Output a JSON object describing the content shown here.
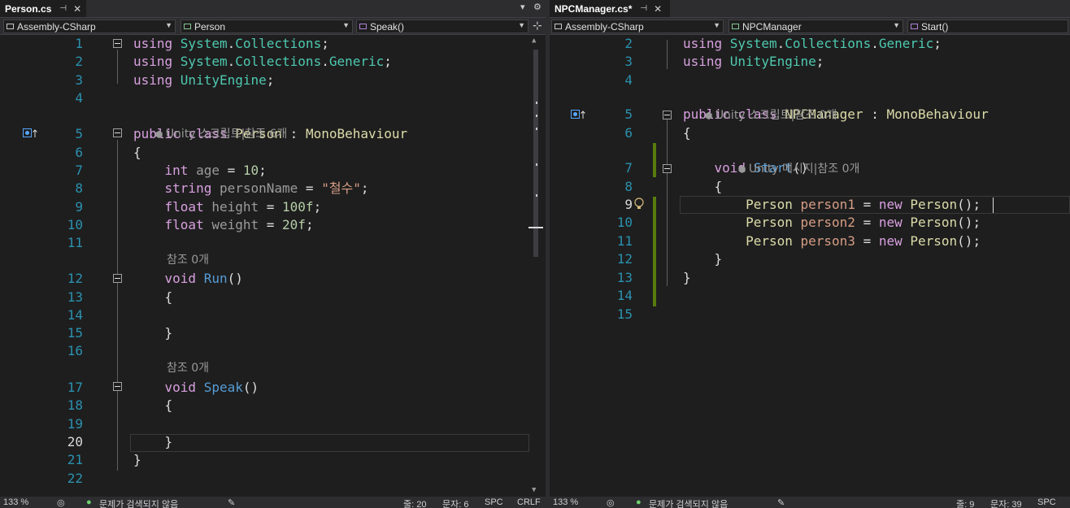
{
  "left_pane": {
    "tab_title": "Person.cs",
    "tab_pin": "⊣",
    "tab_close": "✕",
    "nav_project": "Assembly-CSharp",
    "nav_type": "Person",
    "nav_member": "Speak()",
    "lens_class": "Unity 스크립트|참조 6개",
    "lens_run": "참조 0개",
    "lens_speak": "참조 0개",
    "lines": [
      {
        "n": "1",
        "parts": [
          [
            "kw2",
            "using "
          ],
          [
            "ty",
            "System"
          ],
          [
            "ns",
            "."
          ],
          [
            "ty",
            "Collections"
          ],
          [
            "ns",
            ";"
          ]
        ]
      },
      {
        "n": "2",
        "parts": [
          [
            "kw2",
            "using "
          ],
          [
            "ty",
            "System"
          ],
          [
            "ns",
            "."
          ],
          [
            "ty",
            "Collections"
          ],
          [
            "ns",
            "."
          ],
          [
            "ty",
            "Generic"
          ],
          [
            "ns",
            ";"
          ]
        ]
      },
      {
        "n": "3",
        "parts": [
          [
            "kw2",
            "using "
          ],
          [
            "ty",
            "UnityEngine"
          ],
          [
            "ns",
            ";"
          ]
        ]
      },
      {
        "n": "4",
        "parts": []
      },
      {
        "n": "5",
        "parts": [
          [
            "kw2",
            "public "
          ],
          [
            "kw2",
            "class "
          ],
          [
            "fn",
            "Person"
          ],
          [
            "ns",
            " : "
          ],
          [
            "fn",
            "MonoBehaviour"
          ]
        ]
      },
      {
        "n": "6",
        "parts": [
          [
            "ns",
            "{"
          ]
        ]
      },
      {
        "n": "7",
        "parts": [
          [
            "ns",
            "    "
          ],
          [
            "kw2",
            "int "
          ],
          [
            "dim",
            "age"
          ],
          [
            "ns",
            " = "
          ],
          [
            "num",
            "10"
          ],
          [
            "ns",
            ";"
          ]
        ]
      },
      {
        "n": "8",
        "parts": [
          [
            "ns",
            "    "
          ],
          [
            "kw2",
            "string "
          ],
          [
            "dim",
            "personName"
          ],
          [
            "ns",
            " = "
          ],
          [
            "str",
            "\"철수\""
          ],
          [
            "ns",
            ";"
          ]
        ]
      },
      {
        "n": "9",
        "parts": [
          [
            "ns",
            "    "
          ],
          [
            "kw2",
            "float "
          ],
          [
            "dim",
            "height"
          ],
          [
            "ns",
            " = "
          ],
          [
            "num",
            "100f"
          ],
          [
            "ns",
            ";"
          ]
        ]
      },
      {
        "n": "10",
        "parts": [
          [
            "ns",
            "    "
          ],
          [
            "kw2",
            "float "
          ],
          [
            "dim",
            "weight"
          ],
          [
            "ns",
            " = "
          ],
          [
            "num",
            "20f"
          ],
          [
            "ns",
            ";"
          ]
        ]
      },
      {
        "n": "11",
        "parts": []
      },
      {
        "n": "12",
        "parts": [
          [
            "ns",
            "    "
          ],
          [
            "kw2",
            "void "
          ],
          [
            "kw",
            "Run"
          ],
          [
            "ns",
            "()"
          ]
        ]
      },
      {
        "n": "13",
        "parts": [
          [
            "ns",
            "    {"
          ]
        ]
      },
      {
        "n": "14",
        "parts": []
      },
      {
        "n": "15",
        "parts": [
          [
            "ns",
            "    }"
          ]
        ]
      },
      {
        "n": "16",
        "parts": []
      },
      {
        "n": "17",
        "parts": [
          [
            "ns",
            "    "
          ],
          [
            "kw2",
            "void "
          ],
          [
            "kw",
            "Speak"
          ],
          [
            "ns",
            "()"
          ]
        ]
      },
      {
        "n": "18",
        "parts": [
          [
            "ns",
            "    {"
          ]
        ]
      },
      {
        "n": "19",
        "parts": []
      },
      {
        "n": "20",
        "parts": [
          [
            "ns",
            "    }"
          ]
        ]
      },
      {
        "n": "21",
        "parts": [
          [
            "ns",
            "}"
          ]
        ]
      },
      {
        "n": "22",
        "parts": []
      }
    ],
    "status": {
      "zoom": "133 %",
      "issues": "문제가 검색되지 않음",
      "line": "줄: 20",
      "col": "문자: 6",
      "spc": "SPC",
      "crlf": "CRLF"
    }
  },
  "right_pane": {
    "tab_title": "NPCManager.cs*",
    "tab_pin": "⊣",
    "tab_close": "✕",
    "nav_project": "Assembly-CSharp",
    "nav_type": "NPCManager",
    "nav_member": "Start()",
    "lens_class": "Unity 스크립트|참조 0개",
    "lens_start": "Unity 메시지|참조 0개",
    "lines": [
      {
        "n": "2",
        "parts": [
          [
            "kw2",
            "using "
          ],
          [
            "ty",
            "System"
          ],
          [
            "ns",
            "."
          ],
          [
            "ty",
            "Collections"
          ],
          [
            "ns",
            "."
          ],
          [
            "ty",
            "Generic"
          ],
          [
            "ns",
            ";"
          ]
        ]
      },
      {
        "n": "3",
        "parts": [
          [
            "kw2",
            "using "
          ],
          [
            "ty",
            "UnityEngine"
          ],
          [
            "ns",
            ";"
          ]
        ]
      },
      {
        "n": "4",
        "parts": []
      },
      {
        "n": "5",
        "parts": [
          [
            "kw2",
            "public "
          ],
          [
            "kw2",
            "class "
          ],
          [
            "fn",
            "NPCManager"
          ],
          [
            "ns",
            " : "
          ],
          [
            "fn",
            "MonoBehaviour"
          ]
        ]
      },
      {
        "n": "6",
        "parts": [
          [
            "ns",
            "{"
          ]
        ]
      },
      {
        "n": "7",
        "parts": [
          [
            "ns",
            "    "
          ],
          [
            "kw2",
            "void "
          ],
          [
            "kw",
            "Start"
          ],
          [
            "ns",
            "()"
          ]
        ]
      },
      {
        "n": "8",
        "parts": [
          [
            "ns",
            "    {"
          ]
        ]
      },
      {
        "n": "9",
        "parts": [
          [
            "ns",
            "        "
          ],
          [
            "fn",
            "Person "
          ],
          [
            "str",
            "person1"
          ],
          [
            "ns",
            " = "
          ],
          [
            "kw2",
            "new "
          ],
          [
            "fn",
            "Person"
          ],
          [
            "ns",
            "();"
          ]
        ]
      },
      {
        "n": "10",
        "parts": [
          [
            "ns",
            "        "
          ],
          [
            "fn",
            "Person "
          ],
          [
            "str",
            "person2"
          ],
          [
            "ns",
            " = "
          ],
          [
            "kw2",
            "new "
          ],
          [
            "fn",
            "Person"
          ],
          [
            "ns",
            "();"
          ]
        ]
      },
      {
        "n": "11",
        "parts": [
          [
            "ns",
            "        "
          ],
          [
            "fn",
            "Person "
          ],
          [
            "str",
            "person3"
          ],
          [
            "ns",
            " = "
          ],
          [
            "kw2",
            "new "
          ],
          [
            "fn",
            "Person"
          ],
          [
            "ns",
            "();"
          ]
        ]
      },
      {
        "n": "12",
        "parts": [
          [
            "ns",
            "    }"
          ]
        ]
      },
      {
        "n": "13",
        "parts": [
          [
            "ns",
            "}"
          ]
        ]
      },
      {
        "n": "14",
        "parts": []
      },
      {
        "n": "15",
        "parts": []
      }
    ],
    "status": {
      "zoom": "133 %",
      "issues": "문제가 검색되지 않음",
      "line": "줄: 9",
      "col": "문자: 39",
      "spc": "SPC"
    }
  },
  "icons": {
    "dropdown": "chevron-down-icon",
    "split": "split-editor-icon",
    "lens": "unity-cube-icon",
    "implementation_marker": "implementation-marker-icon",
    "lightbulb": "lightbulb-icon",
    "check": "check-icon"
  },
  "colors": {
    "keyword": "#d8a0df",
    "type": "#4ec9b0",
    "class": "#dcdcaa",
    "string": "#d69d85",
    "number": "#b5cea8",
    "line_number": "#2b91af",
    "change_bar": "#587c0c",
    "background": "#1e1e1e"
  }
}
